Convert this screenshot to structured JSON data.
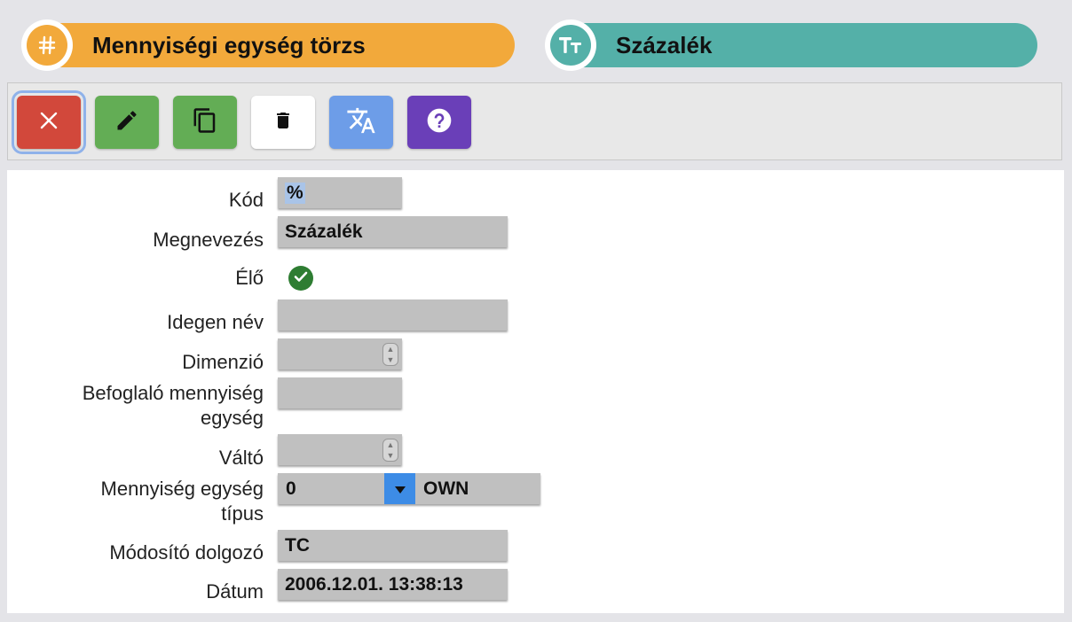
{
  "header": {
    "left_title": "Mennyiségi egység törzs",
    "right_title": "Százalék",
    "left_icon": "hash-icon",
    "right_icon": "text-type-icon",
    "colors": {
      "left": "#f2a93b",
      "right": "#54b0a8"
    }
  },
  "toolbar": {
    "buttons": [
      {
        "name": "close",
        "icon": "close-icon",
        "color": "#d2483b"
      },
      {
        "name": "edit",
        "icon": "pencil-icon",
        "color": "#63ad55"
      },
      {
        "name": "copy",
        "icon": "copy-icon",
        "color": "#63ad55"
      },
      {
        "name": "delete",
        "icon": "trash-icon",
        "color": "#ffffff"
      },
      {
        "name": "translate",
        "icon": "translate-icon",
        "color": "#6d9de8"
      },
      {
        "name": "help",
        "icon": "help-icon",
        "color": "#6a3fb8"
      }
    ]
  },
  "form": {
    "labels": {
      "kod": "Kód",
      "megnevezes": "Megnevezés",
      "elo": "Élő",
      "idegen_nev": "Idegen név",
      "dimenzio": "Dimenzió",
      "befoglalo_1": "Befoglaló mennyiség",
      "befoglalo_2": "egység",
      "valto": "Váltó",
      "tipus_1": "Mennyiség egység",
      "tipus_2": "típus",
      "modosito": "Módosító dolgozó",
      "datum": "Dátum"
    },
    "values": {
      "kod": "%",
      "megnevezes": "Százalék",
      "elo": true,
      "idegen_nev": "",
      "dimenzio": "",
      "befoglalo": "",
      "valto": "",
      "tipus_code": "0",
      "tipus_name": "OWN",
      "modosito": "TC",
      "datum": "2006.12.01. 13:38:13"
    }
  }
}
